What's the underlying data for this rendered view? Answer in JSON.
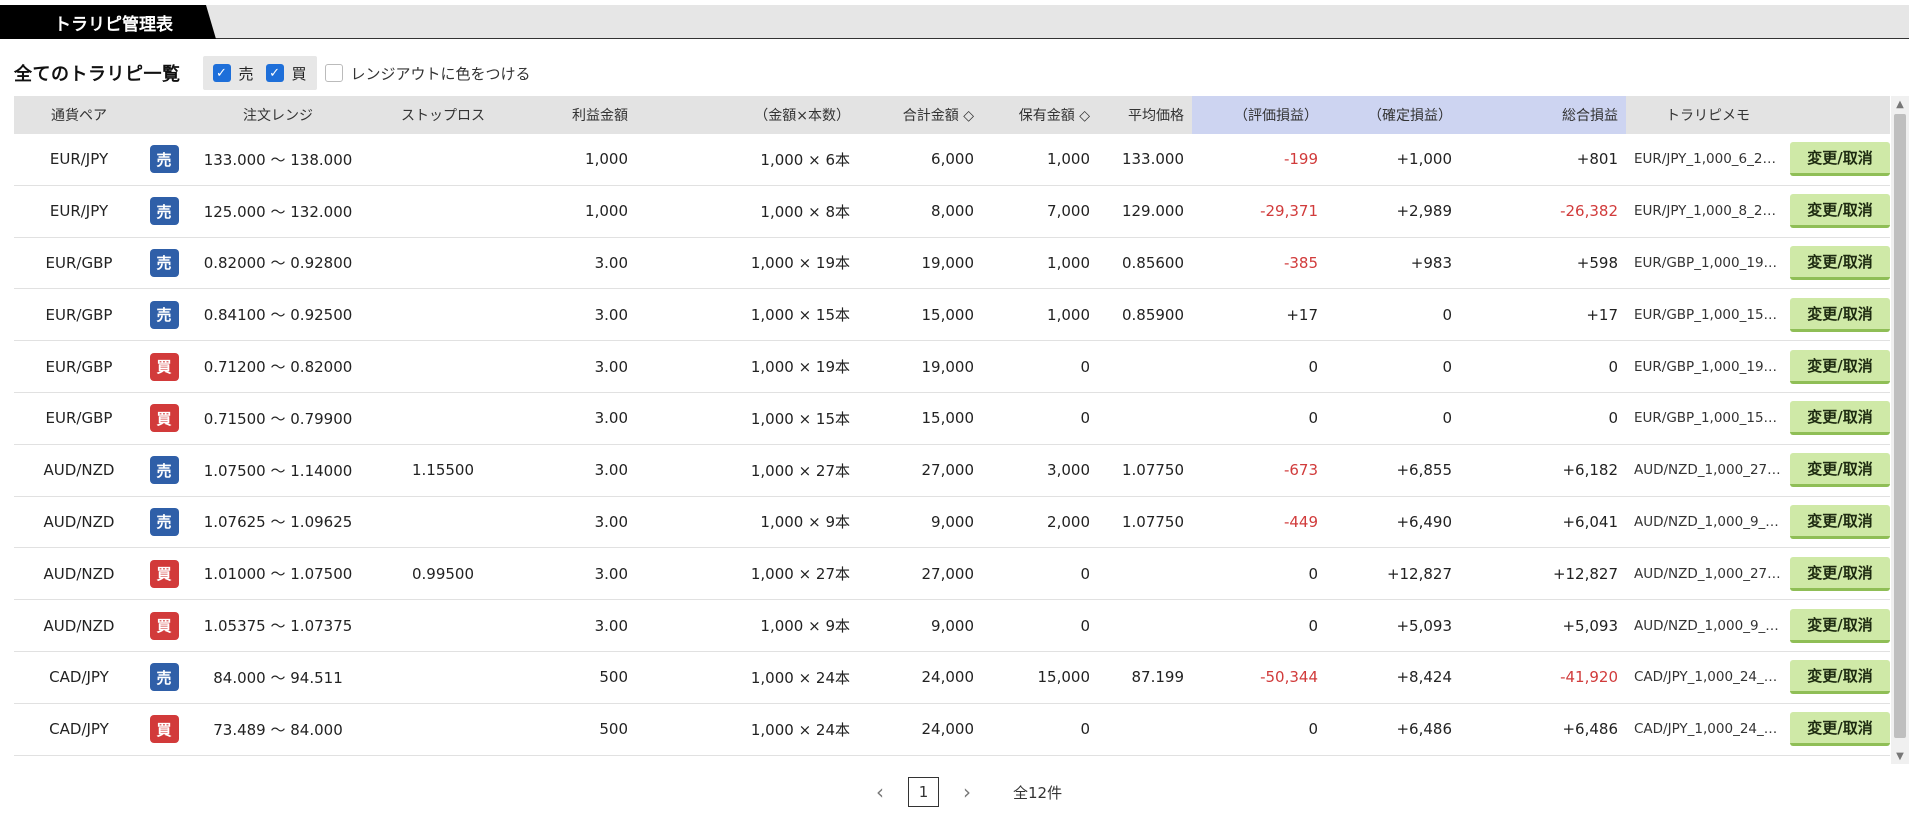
{
  "tab": {
    "label": "トラリピ管理表"
  },
  "filters": {
    "title": "全てのトラリピ一覧",
    "sell_label": "売",
    "buy_label": "買",
    "color_label": "レンジアウトに色をつける"
  },
  "columns": {
    "pair": "通貨ペア",
    "range": "注文レンジ",
    "stop": "ストップロス",
    "profit": "利益金額",
    "amount": "（金額×本数）",
    "total": "合計金額 ◇",
    "hold": "保有金額 ◇",
    "avg": "平均価格",
    "eval": "（評価損益）",
    "confirmed": "（確定損益）",
    "sum": "総合損益",
    "memo": "トラリピメモ"
  },
  "button_label": "変更/取消",
  "rows": [
    {
      "pair": "EUR/JPY",
      "side": "売",
      "range": "133.000 〜 138.000",
      "stop": "",
      "profit": "1,000",
      "amount": "1,000 × 6本",
      "total": "6,000",
      "hold": "1,000",
      "avg": "133.000",
      "eval": "-199",
      "confirmed": "+1,000",
      "sum": "+801",
      "memo": "EUR/JPY_1,000_6_2…"
    },
    {
      "pair": "EUR/JPY",
      "side": "売",
      "range": "125.000 〜 132.000",
      "stop": "",
      "profit": "1,000",
      "amount": "1,000 × 8本",
      "total": "8,000",
      "hold": "7,000",
      "avg": "129.000",
      "eval": "-29,371",
      "confirmed": "+2,989",
      "sum": "-26,382",
      "memo": "EUR/JPY_1,000_8_2…"
    },
    {
      "pair": "EUR/GBP",
      "side": "売",
      "range": "0.82000 〜 0.92800",
      "stop": "",
      "profit": "3.00",
      "amount": "1,000 × 19本",
      "total": "19,000",
      "hold": "1,000",
      "avg": "0.85600",
      "eval": "-385",
      "confirmed": "+983",
      "sum": "+598",
      "memo": "EUR/GBP_1,000_19…"
    },
    {
      "pair": "EUR/GBP",
      "side": "売",
      "range": "0.84100 〜 0.92500",
      "stop": "",
      "profit": "3.00",
      "amount": "1,000 × 15本",
      "total": "15,000",
      "hold": "1,000",
      "avg": "0.85900",
      "eval": "+17",
      "confirmed": "0",
      "sum": "+17",
      "memo": "EUR/GBP_1,000_15…"
    },
    {
      "pair": "EUR/GBP",
      "side": "買",
      "range": "0.71200 〜 0.82000",
      "stop": "",
      "profit": "3.00",
      "amount": "1,000 × 19本",
      "total": "19,000",
      "hold": "0",
      "avg": "",
      "eval": "0",
      "confirmed": "0",
      "sum": "0",
      "memo": "EUR/GBP_1,000_19…"
    },
    {
      "pair": "EUR/GBP",
      "side": "買",
      "range": "0.71500 〜 0.79900",
      "stop": "",
      "profit": "3.00",
      "amount": "1,000 × 15本",
      "total": "15,000",
      "hold": "0",
      "avg": "",
      "eval": "0",
      "confirmed": "0",
      "sum": "0",
      "memo": "EUR/GBP_1,000_15…"
    },
    {
      "pair": "AUD/NZD",
      "side": "売",
      "range": "1.07500 〜 1.14000",
      "stop": "1.15500",
      "profit": "3.00",
      "amount": "1,000 × 27本",
      "total": "27,000",
      "hold": "3,000",
      "avg": "1.07750",
      "eval": "-673",
      "confirmed": "+6,855",
      "sum": "+6,182",
      "memo": "AUD/NZD_1,000_27…"
    },
    {
      "pair": "AUD/NZD",
      "side": "売",
      "range": "1.07625 〜 1.09625",
      "stop": "",
      "profit": "3.00",
      "amount": "1,000 × 9本",
      "total": "9,000",
      "hold": "2,000",
      "avg": "1.07750",
      "eval": "-449",
      "confirmed": "+6,490",
      "sum": "+6,041",
      "memo": "AUD/NZD_1,000_9_…"
    },
    {
      "pair": "AUD/NZD",
      "side": "買",
      "range": "1.01000 〜 1.07500",
      "stop": "0.99500",
      "profit": "3.00",
      "amount": "1,000 × 27本",
      "total": "27,000",
      "hold": "0",
      "avg": "",
      "eval": "0",
      "confirmed": "+12,827",
      "sum": "+12,827",
      "memo": "AUD/NZD_1,000_27…"
    },
    {
      "pair": "AUD/NZD",
      "side": "買",
      "range": "1.05375 〜 1.07375",
      "stop": "",
      "profit": "3.00",
      "amount": "1,000 × 9本",
      "total": "9,000",
      "hold": "0",
      "avg": "",
      "eval": "0",
      "confirmed": "+5,093",
      "sum": "+5,093",
      "memo": "AUD/NZD_1,000_9_…"
    },
    {
      "pair": "CAD/JPY",
      "side": "売",
      "range": "84.000 〜 94.511",
      "stop": "",
      "profit": "500",
      "amount": "1,000 × 24本",
      "total": "24,000",
      "hold": "15,000",
      "avg": "87.199",
      "eval": "-50,344",
      "confirmed": "+8,424",
      "sum": "-41,920",
      "memo": "CAD/JPY_1,000_24_…"
    },
    {
      "pair": "CAD/JPY",
      "side": "買",
      "range": "73.489 〜 84.000",
      "stop": "",
      "profit": "500",
      "amount": "1,000 × 24本",
      "total": "24,000",
      "hold": "0",
      "avg": "",
      "eval": "0",
      "confirmed": "+6,486",
      "sum": "+6,486",
      "memo": "CAD/JPY_1,000_24_…"
    }
  ],
  "pager": {
    "prev": "‹",
    "current": "1",
    "next": "›",
    "count": "全12件"
  },
  "colors": {
    "sell": "#2f5fa8",
    "buy": "#d23a3a",
    "negative": "#d13b3b",
    "button": "#cfe9a7",
    "header_highlight": "#cdd4f1"
  }
}
